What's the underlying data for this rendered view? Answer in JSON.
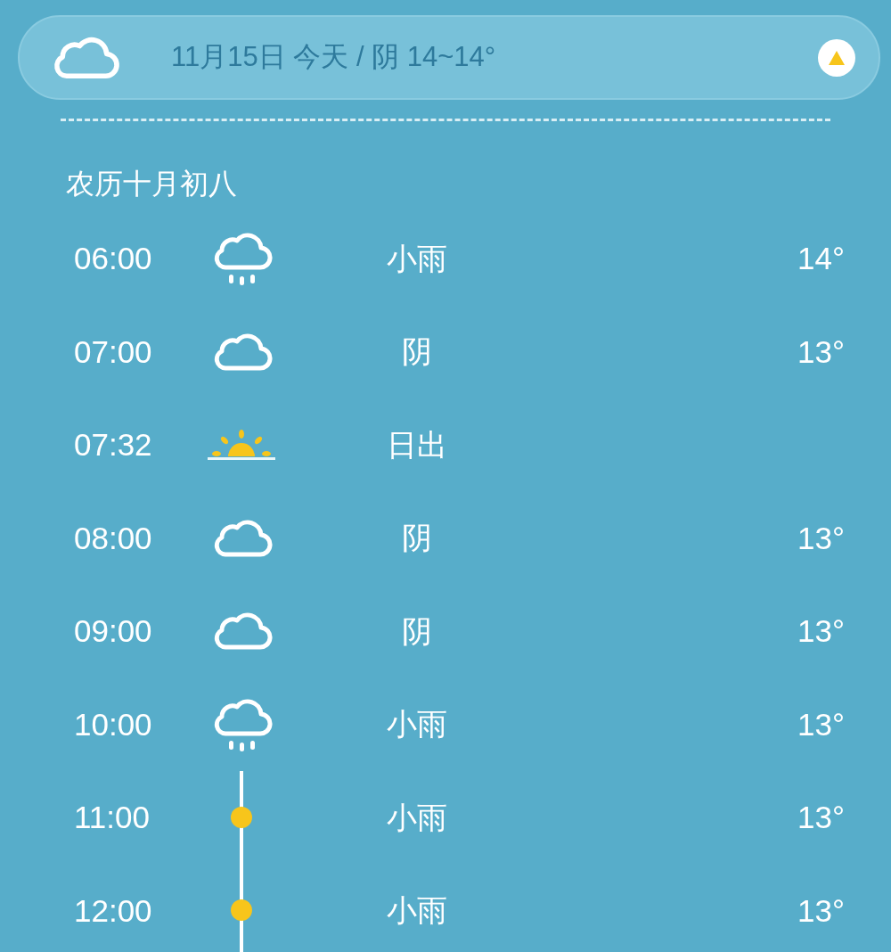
{
  "header": {
    "kind": "cloudy",
    "summary": "11月15日 今天 / 阴 14~14°",
    "expanded": true
  },
  "lunar_date": "农历十月初八",
  "hours": [
    {
      "time": "06:00",
      "kind": "rain",
      "condition": "小雨",
      "temp": "14°"
    },
    {
      "time": "07:00",
      "kind": "cloudy",
      "condition": "阴",
      "temp": "13°"
    },
    {
      "time": "07:32",
      "kind": "sunrise",
      "condition": "日出"
    },
    {
      "time": "08:00",
      "kind": "cloudy",
      "condition": "阴",
      "temp": "13°"
    },
    {
      "time": "09:00",
      "kind": "cloudy",
      "condition": "阴",
      "temp": "13°"
    },
    {
      "time": "10:00",
      "kind": "rain",
      "condition": "小雨",
      "temp": "13°"
    },
    {
      "time": "11:00",
      "kind": "timeline",
      "condition": "小雨",
      "temp": "13°"
    },
    {
      "time": "12:00",
      "kind": "timeline",
      "condition": "小雨",
      "temp": "13°"
    }
  ]
}
